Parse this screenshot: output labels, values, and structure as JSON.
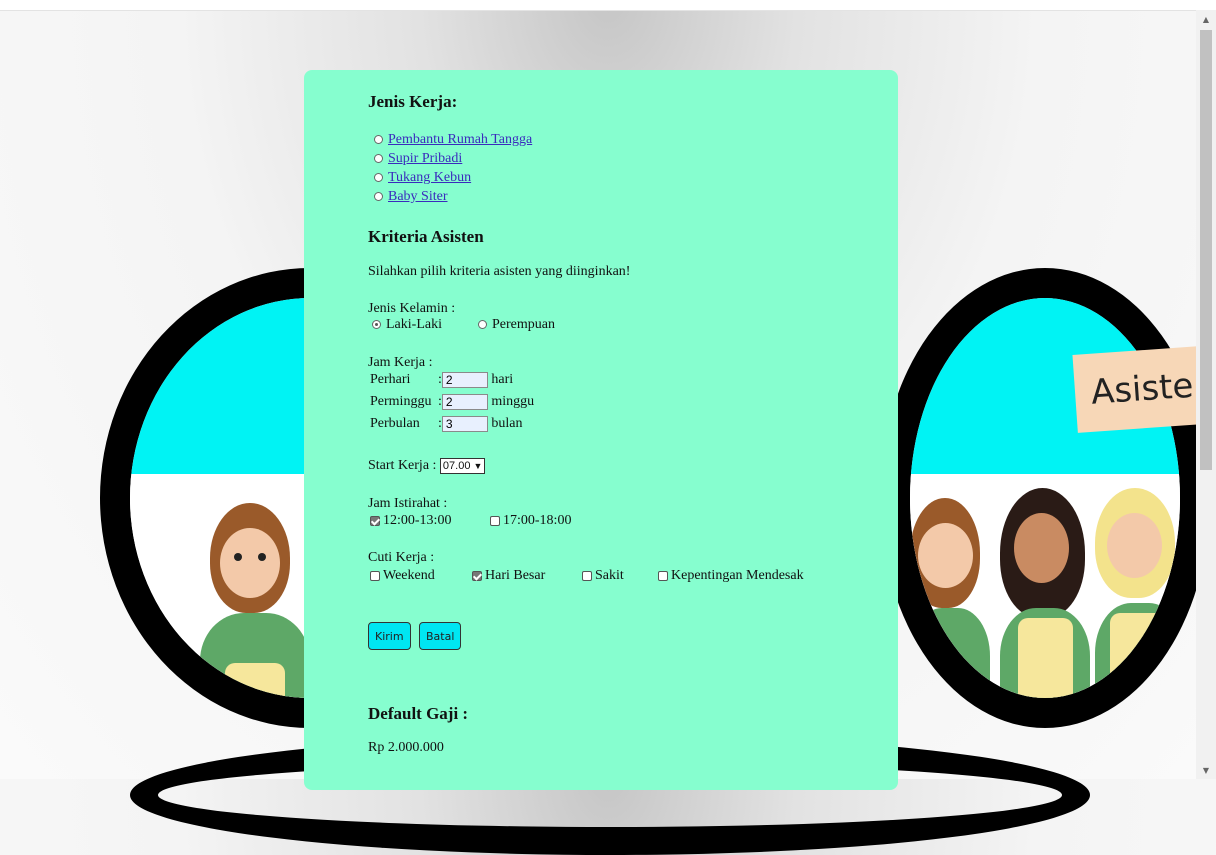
{
  "banner_text": "Asiste",
  "scroll": {
    "up_icon": "▲",
    "down_icon": "▼"
  },
  "jenis_kerja": {
    "heading": "Jenis Kerja:",
    "options": [
      "Pembantu Rumah Tangga",
      "Supir Pribadi",
      "Tukang Kebun",
      "Baby Siter"
    ]
  },
  "kriteria": {
    "heading": "Kriteria Asisten",
    "intro": "Silahkan pilih kriteria asisten yang diinginkan!"
  },
  "jenis_kelamin": {
    "label": "Jenis Kelamin :",
    "options": [
      "Laki-Laki",
      "Perempuan"
    ],
    "selected": "Laki-Laki"
  },
  "jam_kerja": {
    "label": "Jam Kerja :",
    "rows": [
      {
        "label": "Perhari",
        "sep": ":",
        "value": "2",
        "unit": "hari"
      },
      {
        "label": "Perminggu",
        "sep": ":",
        "value": "2",
        "unit": "minggu"
      },
      {
        "label": "Perbulan",
        "sep": ":",
        "value": "3",
        "unit": "bulan"
      }
    ]
  },
  "start_kerja": {
    "label": "Start Kerja :",
    "value": "07.00",
    "arrow": "▼"
  },
  "jam_istirahat": {
    "label": "Jam Istirahat :",
    "options": [
      {
        "label": "12:00-13:00",
        "checked": true
      },
      {
        "label": "17:00-18:00",
        "checked": false
      }
    ]
  },
  "cuti_kerja": {
    "label": "Cuti Kerja :",
    "options": [
      {
        "label": "Weekend",
        "checked": false
      },
      {
        "label": "Hari Besar",
        "checked": true
      },
      {
        "label": "Sakit",
        "checked": false
      },
      {
        "label": "Kepentingan Mendesak",
        "checked": false
      }
    ]
  },
  "buttons": {
    "submit": "Kirim",
    "cancel": "Batal"
  },
  "gaji": {
    "heading": "Default Gaji :",
    "value": "Rp 2.000.000"
  },
  "colors": {
    "panel": "#86fecf",
    "button": "#00e6f2",
    "cyan": "#00f3f4",
    "link": "#3a2bbd"
  }
}
